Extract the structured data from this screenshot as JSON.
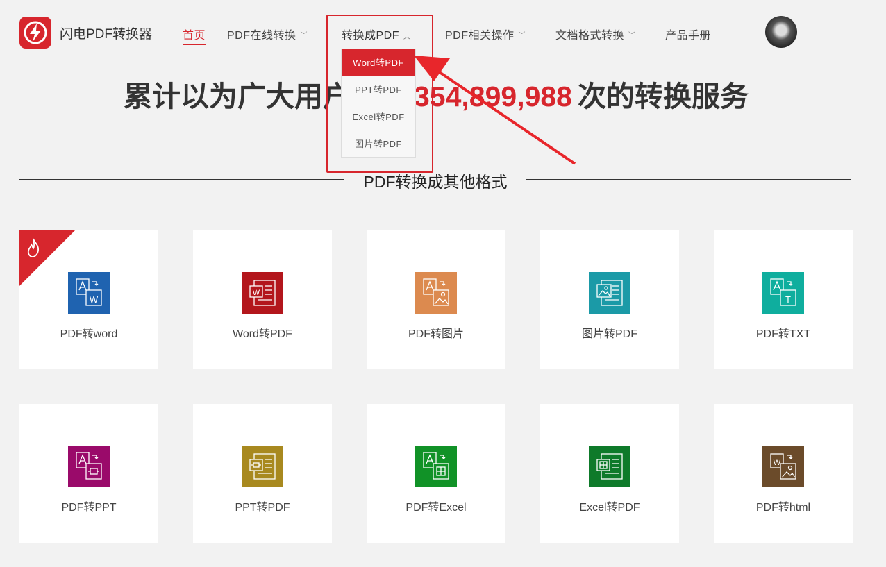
{
  "brand": {
    "name": "闪电PDF转换器"
  },
  "nav": {
    "home": "首页",
    "online": "PDF在线转换",
    "to_pdf": "转换成PDF",
    "pdf_ops": "PDF相关操作",
    "doc_convert": "文档格式转换",
    "manual": "产品手册"
  },
  "dropdown": {
    "items": [
      "Word转PDF",
      "PPT转PDF",
      "Excel转PDF",
      "图片转PDF"
    ],
    "active_index": 0
  },
  "hero": {
    "prefix": "累计以为广大用户提供",
    "count": "354,899,988",
    "suffix": "次的转换服务"
  },
  "section": {
    "title": "PDF转换成其他格式"
  },
  "tools": [
    {
      "label": "PDF转word",
      "color": "#1f63b0",
      "icon": "pdf-to-word-icon",
      "hot": true
    },
    {
      "label": "Word转PDF",
      "color": "#b3161c",
      "icon": "word-to-pdf-icon",
      "hot": false
    },
    {
      "label": "PDF转图片",
      "color": "#dc8a4f",
      "icon": "pdf-to-image-icon",
      "hot": false
    },
    {
      "label": "图片转PDF",
      "color": "#1b9aa7",
      "icon": "image-to-pdf-icon",
      "hot": false
    },
    {
      "label": "PDF转TXT",
      "color": "#0fae9e",
      "icon": "pdf-to-txt-icon",
      "hot": false
    },
    {
      "label": "PDF转PPT",
      "color": "#9a0a6a",
      "icon": "pdf-to-ppt-icon",
      "hot": false
    },
    {
      "label": "PPT转PDF",
      "color": "#a8891f",
      "icon": "ppt-to-pdf-icon",
      "hot": false
    },
    {
      "label": "PDF转Excel",
      "color": "#119227",
      "icon": "pdf-to-excel-icon",
      "hot": false
    },
    {
      "label": "Excel转PDF",
      "color": "#0e7a2a",
      "icon": "excel-to-pdf-icon",
      "hot": false
    },
    {
      "label": "PDF转html",
      "color": "#6b4b2a",
      "icon": "pdf-to-html-icon",
      "hot": false
    }
  ],
  "colors": {
    "accent": "#d7262d",
    "background": "#f2f2f2"
  }
}
